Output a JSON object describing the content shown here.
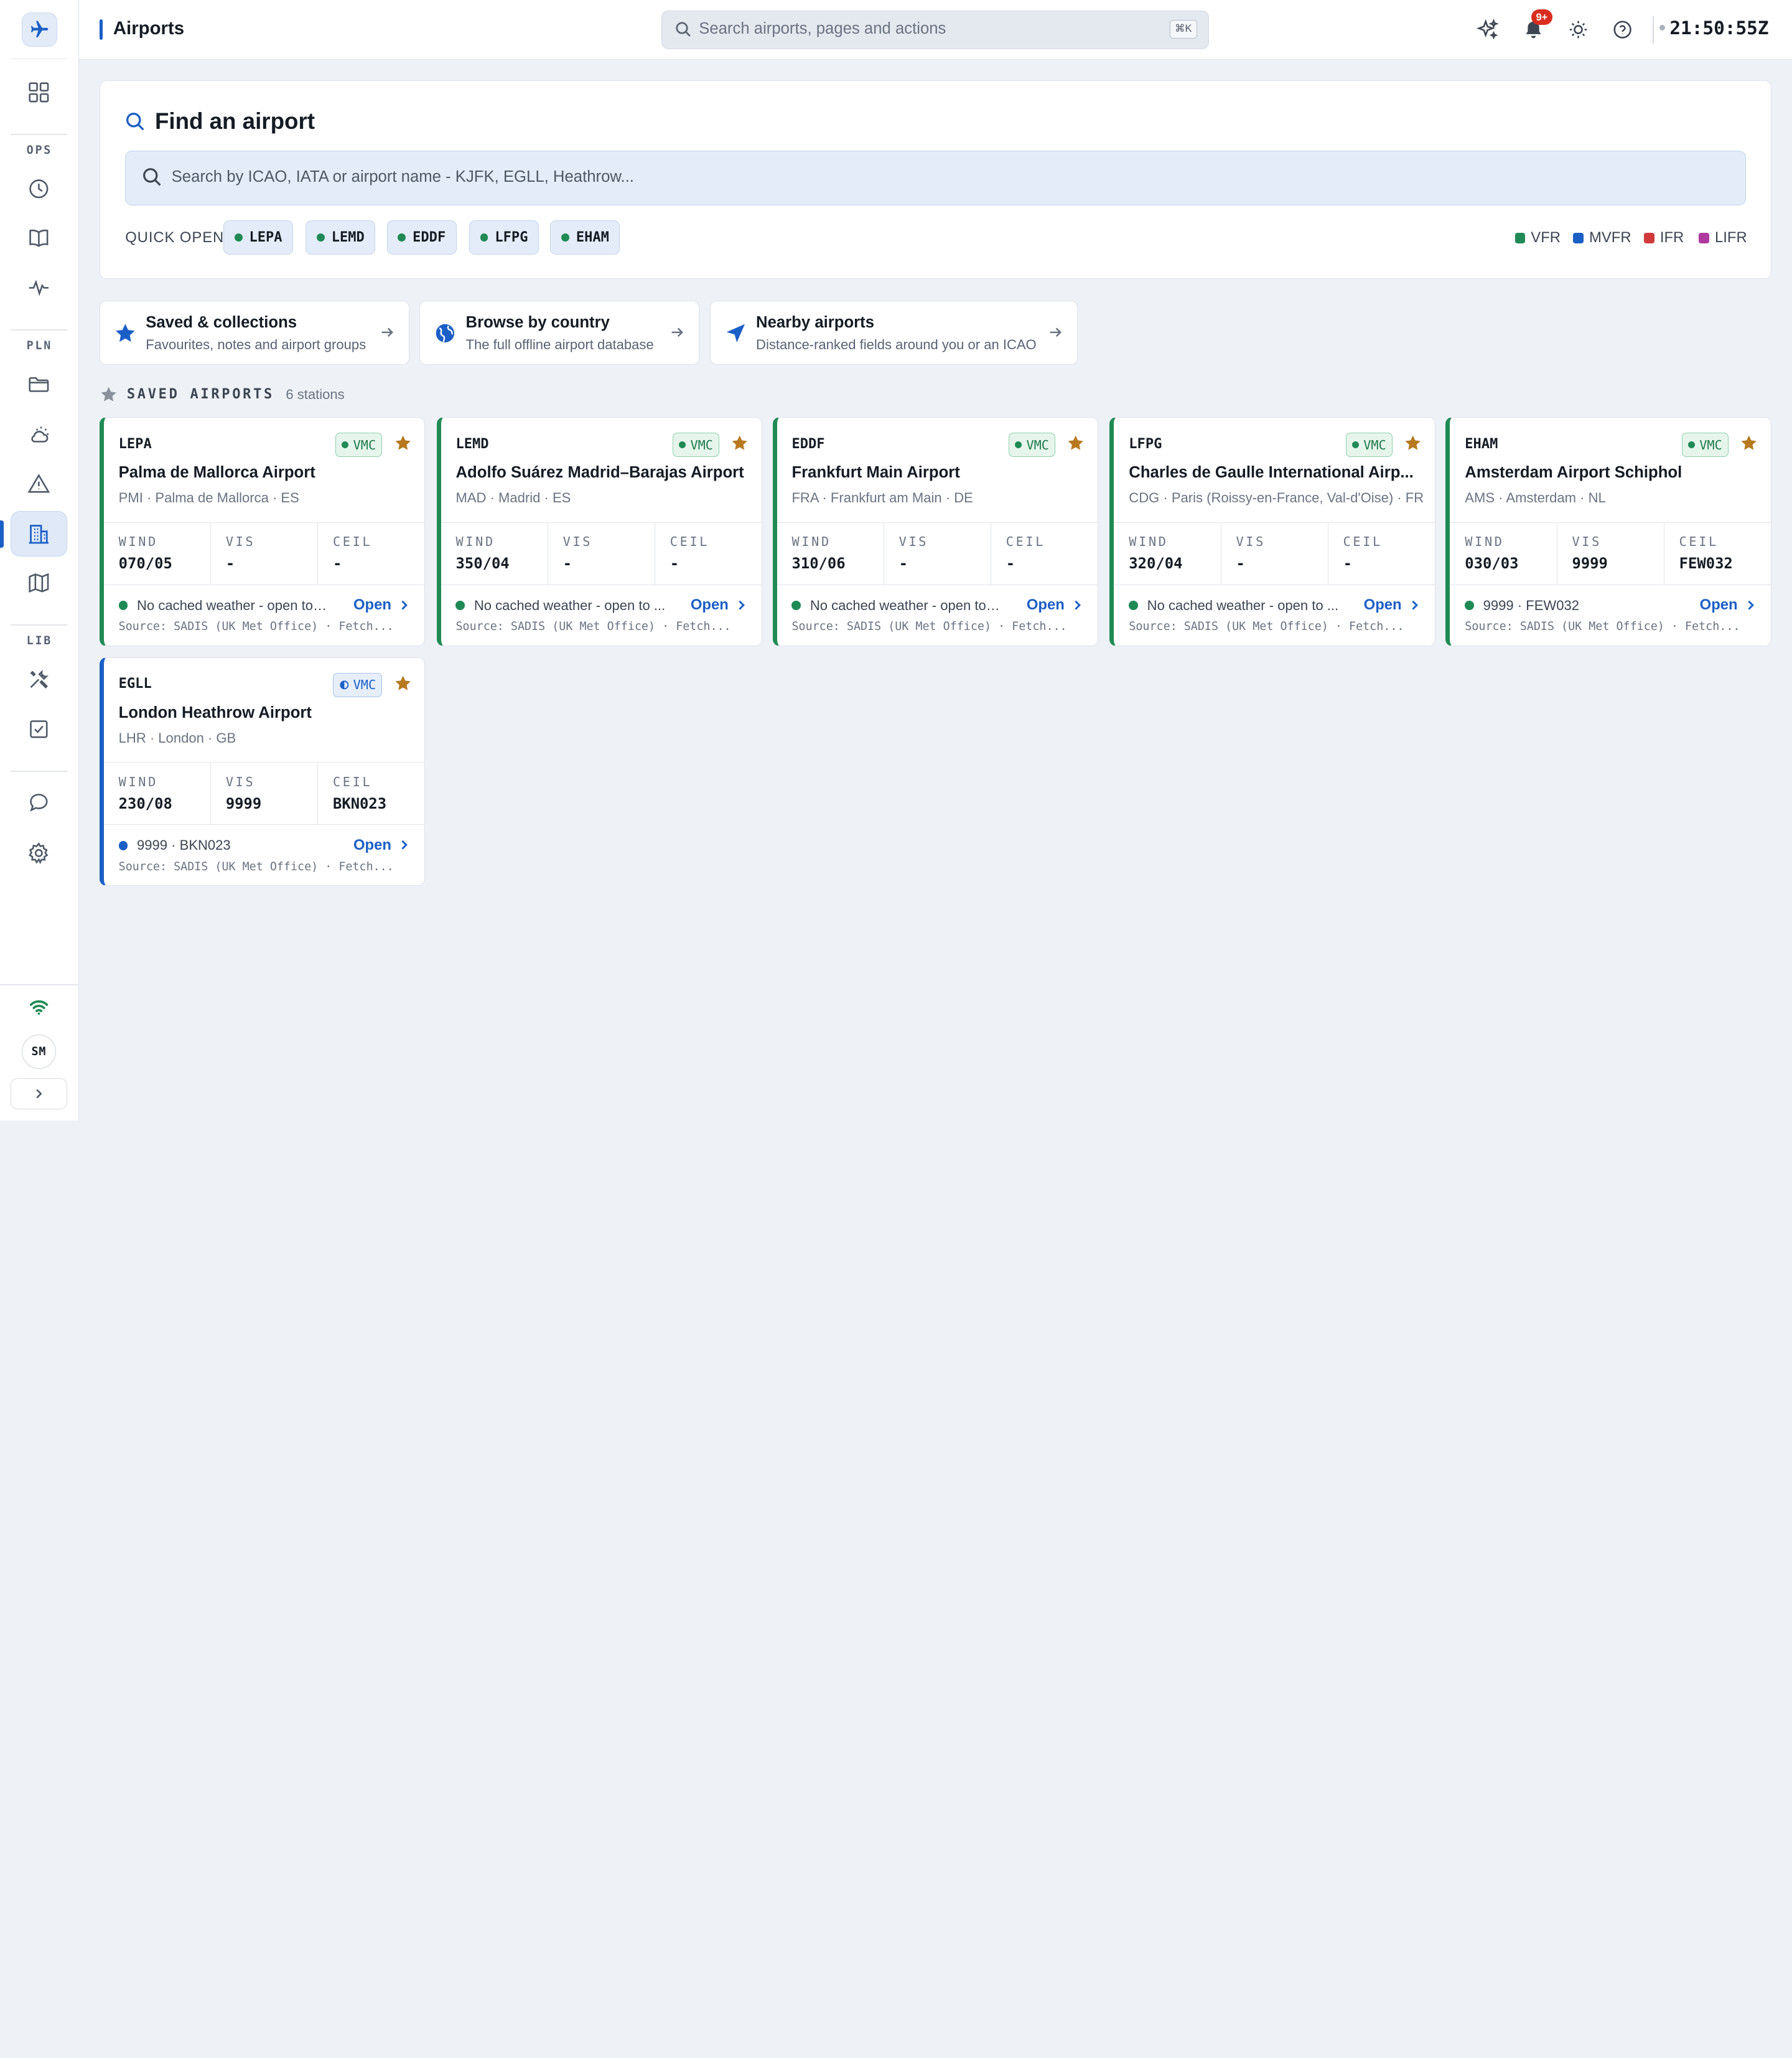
{
  "app": {
    "title": "Airports",
    "clock": "21:50:55Z",
    "user_initials": "SM",
    "notification_count": "9+"
  },
  "global_search": {
    "placeholder": "Search airports, pages and actions",
    "shortcut": "⌘K"
  },
  "sidebar": {
    "sections": {
      "ops": "OPS",
      "pln": "PLN",
      "lib": "LIB"
    },
    "items": [
      {
        "icon": "grid-icon"
      },
      {
        "icon": "clock-icon"
      },
      {
        "icon": "book-icon"
      },
      {
        "icon": "activity-icon"
      },
      {
        "icon": "folder-icon"
      },
      {
        "icon": "cloud-sun-icon"
      },
      {
        "icon": "warning-icon"
      },
      {
        "icon": "building-icon",
        "active": true
      },
      {
        "icon": "map-icon"
      },
      {
        "icon": "tools-icon"
      },
      {
        "icon": "checklist-icon"
      },
      {
        "icon": "chat-icon"
      },
      {
        "icon": "settings-icon"
      }
    ]
  },
  "find": {
    "title": "Find an airport",
    "placeholder": "Search by ICAO, IATA or airport name - KJFK, EGLL, Heathrow...",
    "quick_open_label": "QUICK OPEN",
    "quick_open": [
      "LEPA",
      "LEMD",
      "EDDF",
      "LFPG",
      "EHAM"
    ],
    "legend": [
      {
        "label": "VFR",
        "color": "#1f8a55"
      },
      {
        "label": "MVFR",
        "color": "#1b5fc6"
      },
      {
        "label": "IFR",
        "color": "#d13a3a"
      },
      {
        "label": "LIFR",
        "color": "#b0399e"
      }
    ]
  },
  "quick_links": [
    {
      "title": "Saved & collections",
      "subtitle": "Favourites, notes and airport groups"
    },
    {
      "title": "Browse by country",
      "subtitle": "The full offline airport database"
    },
    {
      "title": "Nearby airports",
      "subtitle": "Distance-ranked fields around you or an ICAO"
    }
  ],
  "saved": {
    "heading": "SAVED AIRPORTS",
    "count": "6 stations",
    "labels": {
      "wind": "WIND",
      "vis": "VIS",
      "ceil": "CEIL",
      "open": "Open"
    },
    "airports": [
      {
        "icao": "LEPA",
        "badge": "VMC",
        "name": "Palma de Mallorca Airport",
        "location": "PMI · Palma de Mallorca · ES",
        "wind": "070/05",
        "vis": "-",
        "ceil": "-",
        "status": "No cached weather - open to lo...",
        "source": "Source: SADIS (UK Met Office) · Fetch..."
      },
      {
        "icao": "LEMD",
        "badge": "VMC",
        "name": "Adolfo Suárez Madrid–Barajas Airport",
        "location": "MAD · Madrid · ES",
        "wind": "350/04",
        "vis": "-",
        "ceil": "-",
        "status": "No cached weather - open to ...",
        "source": "Source: SADIS (UK Met Office) · Fetch..."
      },
      {
        "icao": "EDDF",
        "badge": "VMC",
        "name": "Frankfurt Main Airport",
        "location": "FRA · Frankfurt am Main · DE",
        "wind": "310/06",
        "vis": "-",
        "ceil": "-",
        "status": "No cached weather - open to lo...",
        "source": "Source: SADIS (UK Met Office) · Fetch..."
      },
      {
        "icao": "LFPG",
        "badge": "VMC",
        "name": "Charles de Gaulle International Airp...",
        "location": "CDG · Paris (Roissy-en-France, Val-d'Oise) · FR",
        "wind": "320/04",
        "vis": "-",
        "ceil": "-",
        "status": "No cached weather - open to ...",
        "source": "Source: SADIS (UK Met Office) · Fetch..."
      },
      {
        "icao": "EHAM",
        "badge": "VMC",
        "name": "Amsterdam Airport Schiphol",
        "location": "AMS · Amsterdam · NL",
        "wind": "030/03",
        "vis": "9999",
        "ceil": "FEW032",
        "status": "9999 · FEW032",
        "source": "Source: SADIS (UK Met Office) · Fetch..."
      },
      {
        "icao": "EGLL",
        "badge": "VMC",
        "name": "London Heathrow Airport",
        "location": "LHR · London · GB",
        "wind": "230/08",
        "vis": "9999",
        "ceil": "BKN023",
        "status": "9999 · BKN023",
        "source": "Source: SADIS (UK Met Office) · Fetch...",
        "category": "MVFR"
      }
    ]
  }
}
